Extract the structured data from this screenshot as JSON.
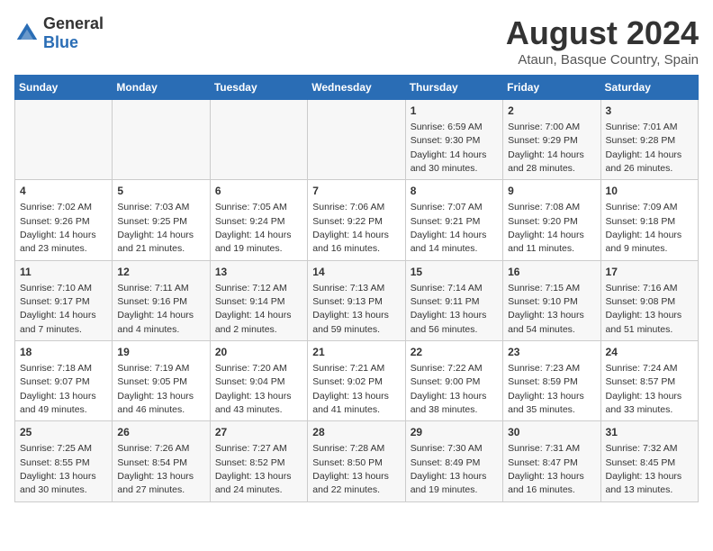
{
  "header": {
    "logo_general": "General",
    "logo_blue": "Blue",
    "title": "August 2024",
    "location": "Ataun, Basque Country, Spain"
  },
  "weekdays": [
    "Sunday",
    "Monday",
    "Tuesday",
    "Wednesday",
    "Thursday",
    "Friday",
    "Saturday"
  ],
  "weeks": [
    [
      {
        "day": "",
        "info": ""
      },
      {
        "day": "",
        "info": ""
      },
      {
        "day": "",
        "info": ""
      },
      {
        "day": "",
        "info": ""
      },
      {
        "day": "1",
        "info": "Sunrise: 6:59 AM\nSunset: 9:30 PM\nDaylight: 14 hours\nand 30 minutes."
      },
      {
        "day": "2",
        "info": "Sunrise: 7:00 AM\nSunset: 9:29 PM\nDaylight: 14 hours\nand 28 minutes."
      },
      {
        "day": "3",
        "info": "Sunrise: 7:01 AM\nSunset: 9:28 PM\nDaylight: 14 hours\nand 26 minutes."
      }
    ],
    [
      {
        "day": "4",
        "info": "Sunrise: 7:02 AM\nSunset: 9:26 PM\nDaylight: 14 hours\nand 23 minutes."
      },
      {
        "day": "5",
        "info": "Sunrise: 7:03 AM\nSunset: 9:25 PM\nDaylight: 14 hours\nand 21 minutes."
      },
      {
        "day": "6",
        "info": "Sunrise: 7:05 AM\nSunset: 9:24 PM\nDaylight: 14 hours\nand 19 minutes."
      },
      {
        "day": "7",
        "info": "Sunrise: 7:06 AM\nSunset: 9:22 PM\nDaylight: 14 hours\nand 16 minutes."
      },
      {
        "day": "8",
        "info": "Sunrise: 7:07 AM\nSunset: 9:21 PM\nDaylight: 14 hours\nand 14 minutes."
      },
      {
        "day": "9",
        "info": "Sunrise: 7:08 AM\nSunset: 9:20 PM\nDaylight: 14 hours\nand 11 minutes."
      },
      {
        "day": "10",
        "info": "Sunrise: 7:09 AM\nSunset: 9:18 PM\nDaylight: 14 hours\nand 9 minutes."
      }
    ],
    [
      {
        "day": "11",
        "info": "Sunrise: 7:10 AM\nSunset: 9:17 PM\nDaylight: 14 hours\nand 7 minutes."
      },
      {
        "day": "12",
        "info": "Sunrise: 7:11 AM\nSunset: 9:16 PM\nDaylight: 14 hours\nand 4 minutes."
      },
      {
        "day": "13",
        "info": "Sunrise: 7:12 AM\nSunset: 9:14 PM\nDaylight: 14 hours\nand 2 minutes."
      },
      {
        "day": "14",
        "info": "Sunrise: 7:13 AM\nSunset: 9:13 PM\nDaylight: 13 hours\nand 59 minutes."
      },
      {
        "day": "15",
        "info": "Sunrise: 7:14 AM\nSunset: 9:11 PM\nDaylight: 13 hours\nand 56 minutes."
      },
      {
        "day": "16",
        "info": "Sunrise: 7:15 AM\nSunset: 9:10 PM\nDaylight: 13 hours\nand 54 minutes."
      },
      {
        "day": "17",
        "info": "Sunrise: 7:16 AM\nSunset: 9:08 PM\nDaylight: 13 hours\nand 51 minutes."
      }
    ],
    [
      {
        "day": "18",
        "info": "Sunrise: 7:18 AM\nSunset: 9:07 PM\nDaylight: 13 hours\nand 49 minutes."
      },
      {
        "day": "19",
        "info": "Sunrise: 7:19 AM\nSunset: 9:05 PM\nDaylight: 13 hours\nand 46 minutes."
      },
      {
        "day": "20",
        "info": "Sunrise: 7:20 AM\nSunset: 9:04 PM\nDaylight: 13 hours\nand 43 minutes."
      },
      {
        "day": "21",
        "info": "Sunrise: 7:21 AM\nSunset: 9:02 PM\nDaylight: 13 hours\nand 41 minutes."
      },
      {
        "day": "22",
        "info": "Sunrise: 7:22 AM\nSunset: 9:00 PM\nDaylight: 13 hours\nand 38 minutes."
      },
      {
        "day": "23",
        "info": "Sunrise: 7:23 AM\nSunset: 8:59 PM\nDaylight: 13 hours\nand 35 minutes."
      },
      {
        "day": "24",
        "info": "Sunrise: 7:24 AM\nSunset: 8:57 PM\nDaylight: 13 hours\nand 33 minutes."
      }
    ],
    [
      {
        "day": "25",
        "info": "Sunrise: 7:25 AM\nSunset: 8:55 PM\nDaylight: 13 hours\nand 30 minutes."
      },
      {
        "day": "26",
        "info": "Sunrise: 7:26 AM\nSunset: 8:54 PM\nDaylight: 13 hours\nand 27 minutes."
      },
      {
        "day": "27",
        "info": "Sunrise: 7:27 AM\nSunset: 8:52 PM\nDaylight: 13 hours\nand 24 minutes."
      },
      {
        "day": "28",
        "info": "Sunrise: 7:28 AM\nSunset: 8:50 PM\nDaylight: 13 hours\nand 22 minutes."
      },
      {
        "day": "29",
        "info": "Sunrise: 7:30 AM\nSunset: 8:49 PM\nDaylight: 13 hours\nand 19 minutes."
      },
      {
        "day": "30",
        "info": "Sunrise: 7:31 AM\nSunset: 8:47 PM\nDaylight: 13 hours\nand 16 minutes."
      },
      {
        "day": "31",
        "info": "Sunrise: 7:32 AM\nSunset: 8:45 PM\nDaylight: 13 hours\nand 13 minutes."
      }
    ]
  ]
}
